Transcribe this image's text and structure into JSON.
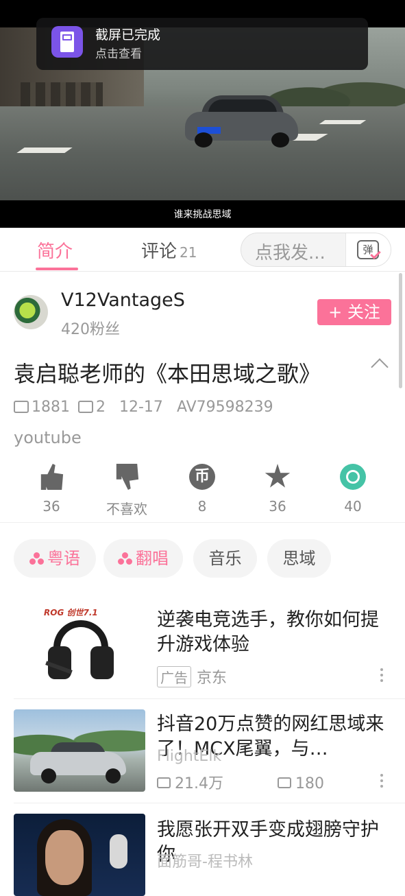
{
  "video": {
    "caption": "谁来挑战思域",
    "plate_text": "粤A8600S"
  },
  "toast": {
    "title": "截屏已完成",
    "subtitle": "点击查看"
  },
  "tabs": {
    "intro": "简介",
    "comments": "评论",
    "comments_count": "21",
    "danmaku_placeholder": "点我发...",
    "danmaku_icon_text": "弹"
  },
  "author": {
    "name": "V12VantageS",
    "fans": "420粉丝",
    "follow_label": "+ 关注"
  },
  "video_info": {
    "title": "袁启聪老师的《本田思域之歌》",
    "views": "1881",
    "danmaku_count": "2",
    "date": "12-17",
    "av": "AV79598239",
    "description": "youtube"
  },
  "actions": [
    {
      "icon": "like-icon",
      "label": "36"
    },
    {
      "icon": "dislike-icon",
      "label": "不喜欢"
    },
    {
      "icon": "coin-icon",
      "label": "8",
      "glyph": "币"
    },
    {
      "icon": "favorite-icon",
      "label": "36"
    },
    {
      "icon": "share-icon",
      "label": "40"
    }
  ],
  "tags": [
    {
      "label": "粤语",
      "style": "pink"
    },
    {
      "label": "翻唱",
      "style": "pink"
    },
    {
      "label": "音乐",
      "style": "grey"
    },
    {
      "label": "思域",
      "style": "grey"
    }
  ],
  "recommendations": [
    {
      "title": "逆袭电竞选手，教你如何提升游戏体验",
      "ad_badge": "广告",
      "source": "京东",
      "thumb_brand": "ROG 创世7.1"
    },
    {
      "title": "抖音20万点赞的网红思域来了！MCX尾翼，与…",
      "uploader": "FlightElk",
      "views": "21.4万",
      "comments": "180"
    },
    {
      "title": "我愿张开双手变成翅膀守护你",
      "uploader": "面筋哥-程书林"
    }
  ],
  "colors": {
    "accent": "#fb7299",
    "share": "#45c3a6",
    "toast_icon": "#7b54e8"
  }
}
